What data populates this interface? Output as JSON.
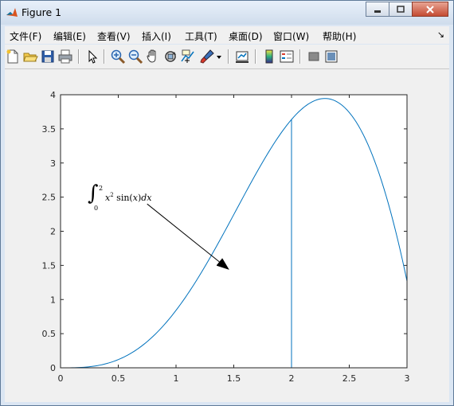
{
  "window": {
    "title": "Figure 1"
  },
  "menu": [
    {
      "id": "file",
      "label": "文件(F)"
    },
    {
      "id": "edit",
      "label": "编辑(E)"
    },
    {
      "id": "view",
      "label": "查看(V)"
    },
    {
      "id": "insert",
      "label": "插入(I)"
    },
    {
      "id": "tools",
      "label": "工具(T)"
    },
    {
      "id": "desktop",
      "label": "桌面(D)"
    },
    {
      "id": "window",
      "label": "窗口(W)"
    },
    {
      "id": "help",
      "label": "帮助(H)"
    }
  ],
  "toolbar_icons": [
    "new-figure-icon",
    "open-file-icon",
    "save-icon",
    "print-icon",
    "pointer-icon",
    "zoom-in-icon",
    "zoom-out-icon",
    "pan-icon",
    "rotate-icon",
    "data-cursor-icon",
    "brush-icon",
    "link-plot-icon",
    "colorbar-icon",
    "legend-icon",
    "hide-plot-tools-icon",
    "show-plot-tools-icon"
  ],
  "chart_data": {
    "type": "line",
    "function": "x^2 sin(x)",
    "x_range": [
      0,
      3
    ],
    "xlim": [
      0,
      3
    ],
    "ylim": [
      0,
      4
    ],
    "xticks": [
      "0",
      "0.5",
      "1",
      "1.5",
      "2",
      "2.5",
      "3"
    ],
    "yticks": [
      "0",
      "0.5",
      "1",
      "1.5",
      "2",
      "2.5",
      "3",
      "3.5",
      "4"
    ],
    "series": [
      {
        "x": [
          0,
          0.25,
          0.5,
          0.75,
          1,
          1.25,
          1.5,
          1.75,
          2,
          2.25,
          2.5,
          2.75,
          3
        ],
        "y": [
          0,
          0.015,
          0.12,
          0.38,
          0.84,
          1.5,
          2.24,
          2.99,
          3.64,
          3.94,
          3.74,
          2.89,
          1.27
        ]
      }
    ],
    "vertical_line": {
      "x": 2,
      "y_from": 0,
      "y_to": 3.64
    },
    "annotation": {
      "text_latex": "\\int_0^2 x^2\\sin(x)dx",
      "arrow_from": [
        0.75,
        2.4
      ],
      "arrow_to": [
        1.45,
        1.45
      ]
    },
    "line_color": "#0072bd",
    "grid": false
  }
}
